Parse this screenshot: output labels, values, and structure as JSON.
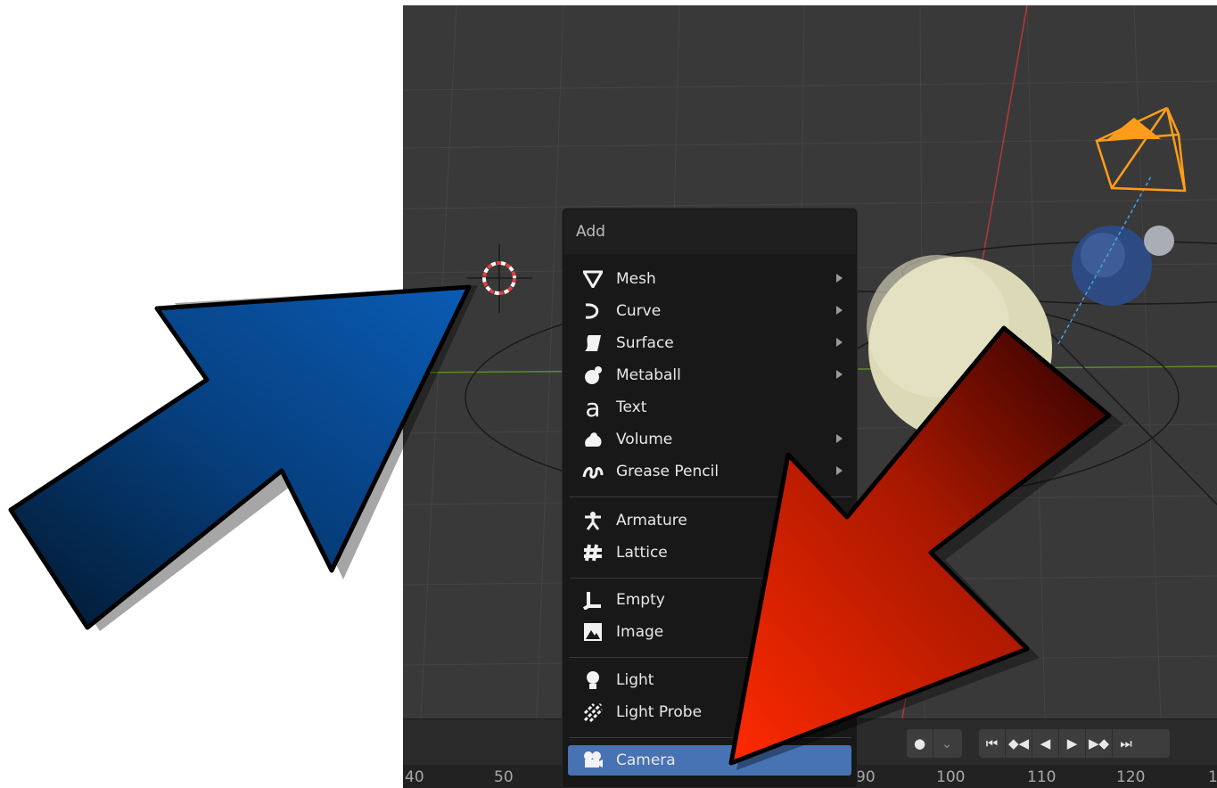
{
  "menu": {
    "title": "Add",
    "items": [
      {
        "label": "Mesh",
        "icon": "mesh-icon",
        "submenu": true
      },
      {
        "label": "Curve",
        "icon": "curve-icon",
        "submenu": true
      },
      {
        "label": "Surface",
        "icon": "surface-icon",
        "submenu": true
      },
      {
        "label": "Metaball",
        "icon": "metaball-icon",
        "submenu": true
      },
      {
        "label": "Text",
        "icon": "text-icon",
        "submenu": false
      },
      {
        "label": "Volume",
        "icon": "volume-icon",
        "submenu": true
      },
      {
        "label": "Grease Pencil",
        "icon": "grease-pencil-icon",
        "submenu": true
      },
      {
        "label": "Armature",
        "icon": "armature-icon",
        "submenu": false
      },
      {
        "label": "Lattice",
        "icon": "lattice-icon",
        "submenu": false
      },
      {
        "label": "Empty",
        "icon": "empty-icon",
        "submenu": true
      },
      {
        "label": "Image",
        "icon": "image-icon",
        "submenu": false
      },
      {
        "label": "Light",
        "icon": "light-icon",
        "submenu": true
      },
      {
        "label": "Light Probe",
        "icon": "light-probe-icon",
        "submenu": true
      },
      {
        "label": "Camera",
        "icon": "camera-icon",
        "submenu": false,
        "active": true
      }
    ]
  },
  "timeline": {
    "ticks": [
      "40",
      "50",
      "90",
      "100",
      "110",
      "120",
      "1"
    ]
  },
  "colors": {
    "highlight": "#4772b3",
    "blue_arrow": "#0a5cb5",
    "red_arrow": "#ff2a00",
    "camera": "#ff9d1a"
  }
}
